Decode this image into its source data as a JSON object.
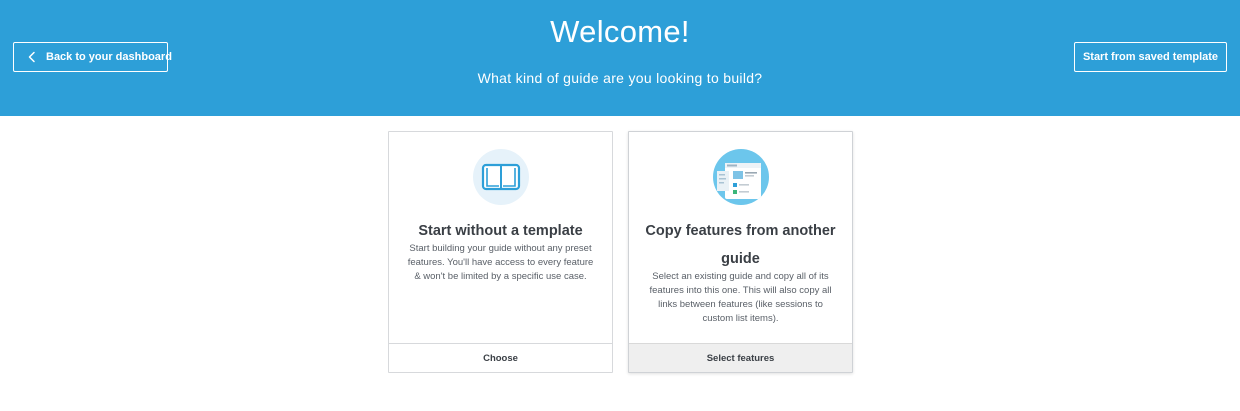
{
  "header": {
    "title": "Welcome!",
    "subtitle": "What kind of guide are you looking to build?",
    "back_label": "Back to your dashboard",
    "saved_template_label": "Start from saved template"
  },
  "cards": [
    {
      "title": "Start without a template",
      "description": "Start building your guide without any preset features. You'll have access to every feature & won't be limited by a specific use case.",
      "action_label": "Choose",
      "icon": "book-icon"
    },
    {
      "title": "Copy features from another guide",
      "description": "Select an existing guide and copy all of its features into this one. This will also copy all links between features (like sessions to custom list items).",
      "action_label": "Select features",
      "icon": "copy-guide-icon"
    }
  ],
  "colors": {
    "header_bg": "#2d9fd8",
    "text": "#3a3f45",
    "card_border": "#d7d9dc",
    "icon_bg_light": "#e6f2fa",
    "icon_bg_blue": "#6cc6ec"
  }
}
